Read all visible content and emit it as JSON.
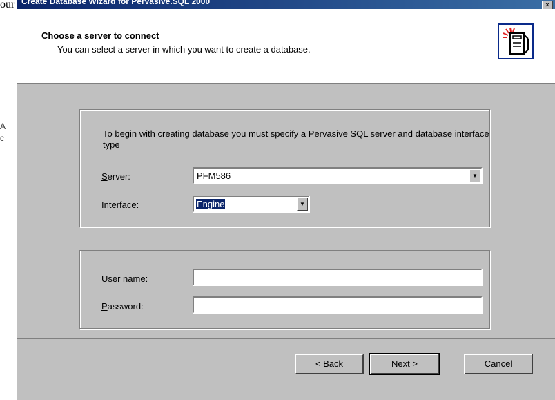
{
  "caption": "our server & interface, which will be engine",
  "left_fragments": [
    "A",
    "c"
  ],
  "window": {
    "title": "Create Database Wizard for Pervasive.SQL 2000",
    "close_glyph": "✕"
  },
  "header": {
    "title": "Choose a server to connect",
    "subtitle": "You can select a server in which you want to create a database.",
    "icon": "wizard-server-icon"
  },
  "connection": {
    "intro": "To begin with creating database you must specify a Pervasive SQL server and database interface type",
    "server_label_u": "S",
    "server_label_rest": "erver:",
    "server_value": "PFM586",
    "interface_label_u": "I",
    "interface_label_rest": "nterface:",
    "interface_value": "Engine"
  },
  "credentials": {
    "username_label_u": "U",
    "username_label_rest": "ser name:",
    "username_value": "",
    "password_label_u": "P",
    "password_label_rest": "assword:",
    "password_value": ""
  },
  "buttons": {
    "back_prefix": "< ",
    "back_u": "B",
    "back_rest": "ack",
    "next_u": "N",
    "next_rest": "ext >",
    "cancel": "Cancel"
  },
  "colors": {
    "titlebar": "#0a246a",
    "dialog": "#c0c0c0",
    "selection": "#0a246a"
  }
}
